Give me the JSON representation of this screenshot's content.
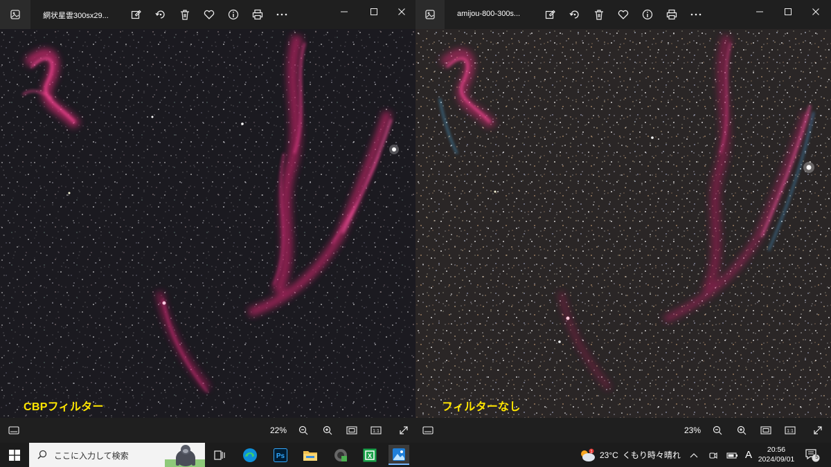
{
  "windows": [
    {
      "title": "網状星雲300sx29...",
      "caption": "CBPフィルター",
      "zoom": "22%"
    },
    {
      "title": "amijou-800-300s...",
      "caption": "フィルターなし",
      "zoom": "23%"
    }
  ],
  "toolbar_icons": [
    "edit-icon",
    "rotate-icon",
    "delete-icon",
    "favorite-icon",
    "info-icon",
    "print-icon",
    "more-icon"
  ],
  "window_controls": [
    "minimize-icon",
    "maximize-icon",
    "close-icon"
  ],
  "statusbar_icons": [
    "filmstrip-icon",
    "zoom-out-icon",
    "zoom-in-icon",
    "fit-icon",
    "actual-size-icon",
    "fullscreen-icon"
  ],
  "taskbar": {
    "search_placeholder": "ここに入力して検索",
    "apps": [
      "task-view-icon",
      "edge-icon",
      "photoshop-icon",
      "file-explorer-icon",
      "app-icon",
      "green-app-icon",
      "photos-icon"
    ],
    "weather_temp": "23°C",
    "weather_text": "くもり時々晴れ",
    "ime": "A",
    "time": "20:56",
    "date": "2024/09/01",
    "notification_count": "5"
  },
  "colors": {
    "window_bg": "#1f1f1f",
    "caption": "#ffe600",
    "nebula": "#e0307a",
    "taskbar": "#1c1c1c"
  }
}
